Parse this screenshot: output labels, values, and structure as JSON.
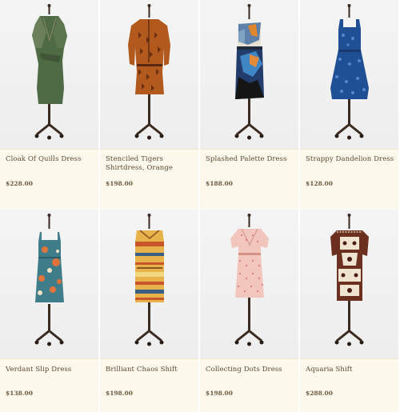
{
  "products": [
    {
      "name": "Cloak Of Quills Dress",
      "price": "$228.00"
    },
    {
      "name": "Stenciled Tigers Shirtdress, Orange",
      "price": "$198.00"
    },
    {
      "name": "Splashed Palette Dress",
      "price": "$188.00"
    },
    {
      "name": "Strappy Dandelion Dress",
      "price": "$128.00"
    },
    {
      "name": "Verdant Slip Dress",
      "price": "$138.00"
    },
    {
      "name": "Brilliant Chaos Shift",
      "price": "$198.00"
    },
    {
      "name": "Collecting Dots Dress",
      "price": "$198.00"
    },
    {
      "name": "Aquaria Shift",
      "price": "$288.00"
    }
  ]
}
